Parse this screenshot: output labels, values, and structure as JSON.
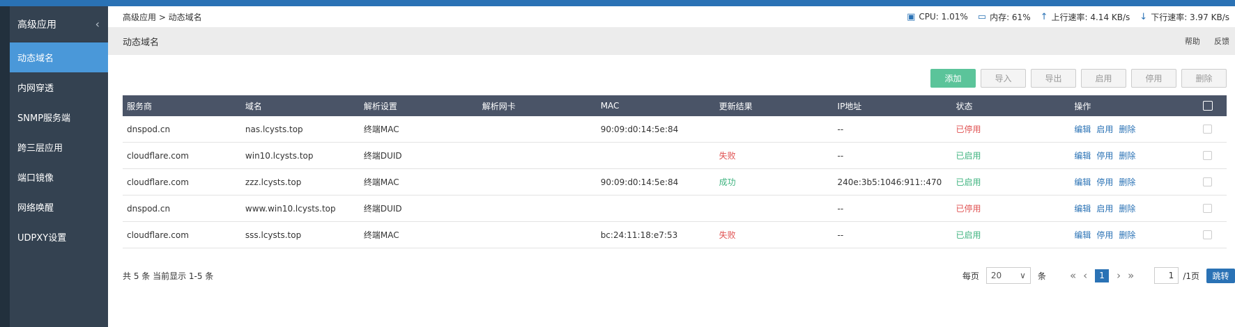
{
  "sidebar": {
    "title": "高级应用",
    "items": [
      "动态域名",
      "内网穿透",
      "SNMP服务端",
      "跨三层应用",
      "端口镜像",
      "网络唤醒",
      "UDPXY设置"
    ]
  },
  "breadcrumb": "高级应用 > 动态域名",
  "stats": {
    "cpu": "CPU: 1.01%",
    "mem": "内存: 61%",
    "up": "上行速率: 4.14 KB/s",
    "down": "下行速率: 3.97 KB/s"
  },
  "page": {
    "title": "动态域名",
    "help": "帮助",
    "feedback": "反馈"
  },
  "toolbar": {
    "add": "添加",
    "import": "导入",
    "export": "导出",
    "enable": "启用",
    "disable": "停用",
    "delete": "删除"
  },
  "table": {
    "headers": [
      "服务商",
      "域名",
      "解析设置",
      "解析网卡",
      "MAC",
      "更新结果",
      "IP地址",
      "状态",
      "操作"
    ],
    "rows": [
      {
        "provider": "dnspod.cn",
        "domain": "nas.lcysts.top",
        "resolve": "终端MAC",
        "nic": "",
        "mac": "90:09:d0:14:5e:84",
        "result": "",
        "result_color": "",
        "ip": "--",
        "status": "已停用",
        "status_color": "red",
        "ops": [
          "编辑",
          "启用",
          "删除"
        ]
      },
      {
        "provider": "cloudflare.com",
        "domain": "win10.lcysts.top",
        "resolve": "终端DUID",
        "nic": "",
        "mac": "",
        "result": "失败",
        "result_color": "red",
        "ip": "--",
        "status": "已启用",
        "status_color": "green",
        "ops": [
          "编辑",
          "停用",
          "删除"
        ]
      },
      {
        "provider": "cloudflare.com",
        "domain": "zzz.lcysts.top",
        "resolve": "终端MAC",
        "nic": "",
        "mac": "90:09:d0:14:5e:84",
        "result": "成功",
        "result_color": "green",
        "ip": "240e:3b5:1046:911::470",
        "status": "已启用",
        "status_color": "green",
        "ops": [
          "编辑",
          "停用",
          "删除"
        ]
      },
      {
        "provider": "dnspod.cn",
        "domain": "www.win10.lcysts.top",
        "resolve": "终端DUID",
        "nic": "",
        "mac": "",
        "result": "",
        "result_color": "",
        "ip": "--",
        "status": "已停用",
        "status_color": "red",
        "ops": [
          "编辑",
          "启用",
          "删除"
        ]
      },
      {
        "provider": "cloudflare.com",
        "domain": "sss.lcysts.top",
        "resolve": "终端MAC",
        "nic": "",
        "mac": "bc:24:11:18:e7:53",
        "result": "失败",
        "result_color": "red",
        "ip": "--",
        "status": "已启用",
        "status_color": "green",
        "ops": [
          "编辑",
          "停用",
          "删除"
        ]
      }
    ]
  },
  "footer": {
    "summary": "共 5 条 当前显示 1-5 条",
    "per_page_label": "每页",
    "per_page_value": "20",
    "unit": "条",
    "current_page": "1",
    "jump_value": "1",
    "total_pages": "/1页",
    "jump": "跳转"
  },
  "colors": {
    "accent": "#2a72b5",
    "sidebar": "#344251",
    "active": "#4a98d9",
    "header": "#4a5467",
    "add": "#5bc49a",
    "red": "#e05252",
    "green": "#3fb37f"
  },
  "icons": {
    "cpu": "chip-icon",
    "mem": "monitor-icon",
    "up": "arrow-up-icon",
    "down": "arrow-down-icon",
    "collapse": "chevron-left-icon"
  }
}
